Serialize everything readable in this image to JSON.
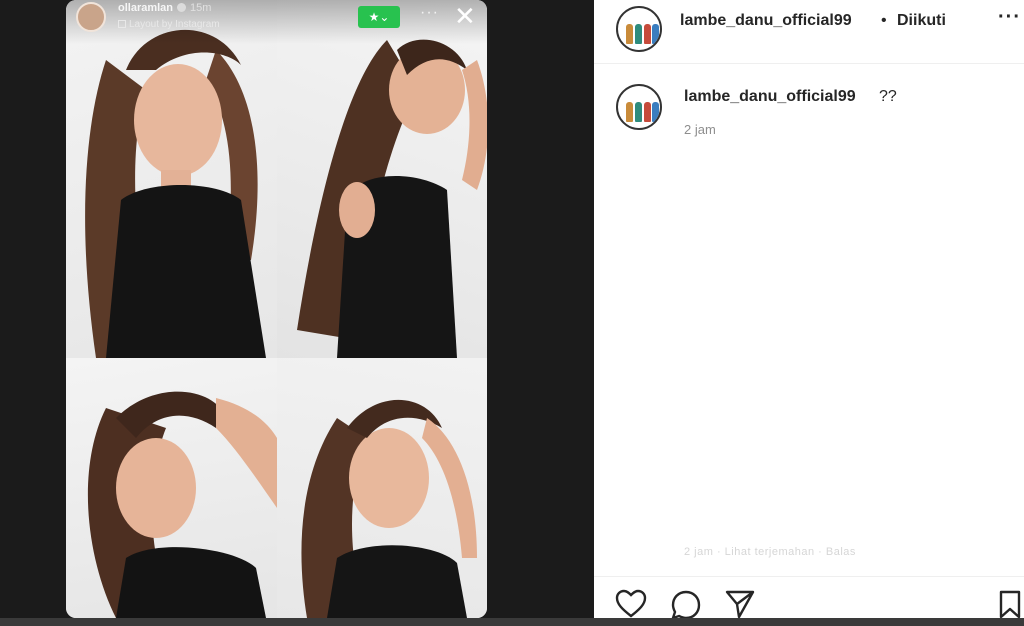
{
  "story": {
    "username": "ollaramlan",
    "time": "15m",
    "layout_label": "Layout by Instagram",
    "close_friends_label": "★⌄",
    "more_label": "···",
    "close_label": "✕"
  },
  "post": {
    "header": {
      "username": "lambe_danu_official99",
      "separator": "•",
      "follow_status": "Diikuti",
      "more_label": "···"
    },
    "caption": {
      "username": "lambe_danu_official99",
      "text": "??",
      "time": "2 jam"
    },
    "faded_meta": "2 jam · Lihat terjemahan · Balas",
    "actions": [
      "heart-icon",
      "comment-icon",
      "share-icon",
      "save-icon"
    ]
  },
  "colors": {
    "close_friends_green": "#28c24f",
    "text_primary": "#262626",
    "text_secondary": "#8e8e8e",
    "panel_background": "#ffffff",
    "page_background": "#1b1b1b"
  }
}
